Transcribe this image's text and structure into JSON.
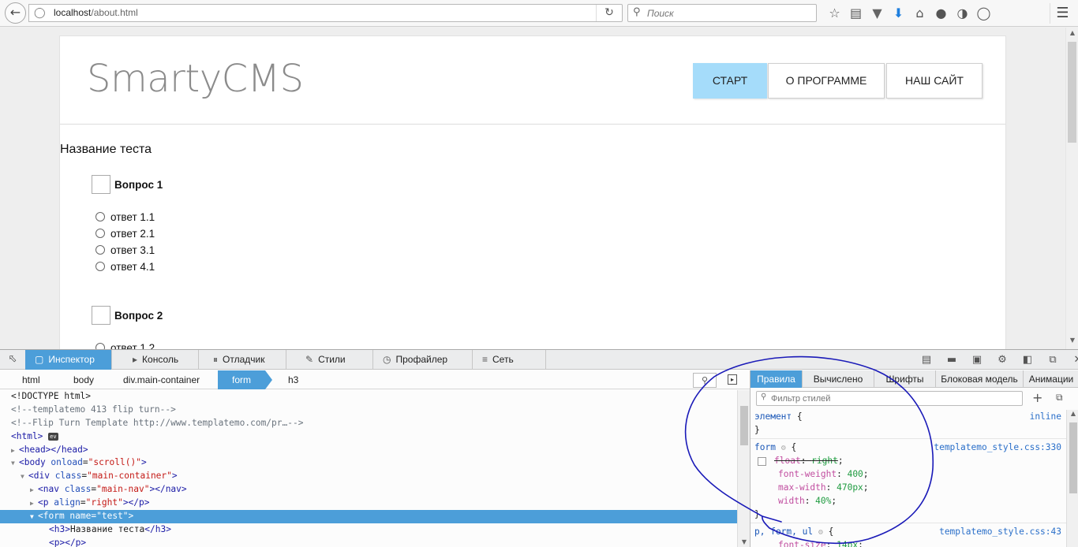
{
  "browser": {
    "url_host": "localhost",
    "url_path": "/about.html",
    "search_placeholder": "Поиск"
  },
  "site": {
    "logo": "SmartyCMS",
    "nav": [
      {
        "label": "СТАРТ"
      },
      {
        "label": "О ПРОГРАММЕ"
      },
      {
        "label": "НАШ САЙТ"
      }
    ],
    "test_title": "Название теста",
    "questions": [
      {
        "label": "Вопрос 1",
        "answers": [
          "ответ 1.1",
          "ответ 2.1",
          "ответ 3.1",
          "ответ 4.1"
        ]
      },
      {
        "label": "Вопрос 2",
        "answers": [
          "ответ 1.2"
        ]
      }
    ]
  },
  "devtools": {
    "tabs": [
      {
        "label": "Инспектор",
        "icon": "inspector-icon"
      },
      {
        "label": "Консоль",
        "icon": "console-icon"
      },
      {
        "label": "Отладчик",
        "icon": "debugger-icon"
      },
      {
        "label": "Стили",
        "icon": "style-editor-icon"
      },
      {
        "label": "Профайлер",
        "icon": "profiler-icon"
      },
      {
        "label": "Сеть",
        "icon": "network-icon"
      }
    ],
    "breadcrumbs": [
      "html",
      "body",
      "div.main-container",
      "form",
      "h3"
    ],
    "markup": {
      "doctype": "<!DOCTYPE html>",
      "comment1": "<!--templatemo 413 flip turn-->",
      "comment2": "<!--Flip Turn Template http://www.templatemo.com/pr…-->",
      "event_badge": "ev"
    },
    "side_tabs": [
      "Правила",
      "Вычислено",
      "Шрифты",
      "Блоковая модель",
      "Анимации"
    ],
    "filter_placeholder": "Фильтр стилей",
    "rules": {
      "element_selector": "элемент",
      "element_source": "inline",
      "form_selector": "form",
      "form_source": "templatemo_style.css:330",
      "form_props": [
        {
          "name": "float",
          "value": "right",
          "disabled": true
        },
        {
          "name": "font-weight",
          "value": "400",
          "disabled": false
        },
        {
          "name": "max-width",
          "value": "470px",
          "disabled": false
        },
        {
          "name": "width",
          "value": "40%",
          "disabled": false
        }
      ],
      "p_selector": "p, form, ul",
      "p_source": "templatemo_style.css:43",
      "p_prop": {
        "name": "font-size",
        "value": "14px"
      }
    }
  },
  "colors": {
    "accent": "#4c9ed9",
    "nav_active": "#a5dcfa",
    "annotation": "#1a1ab8"
  }
}
